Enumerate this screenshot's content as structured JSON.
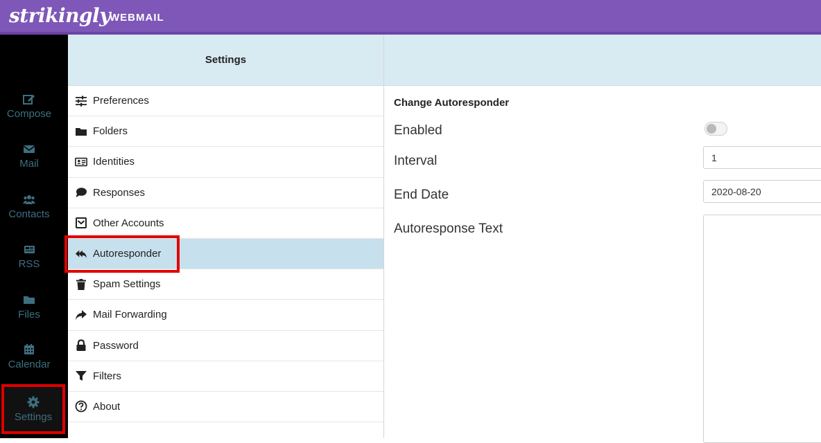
{
  "brand": {
    "logo": "strikingly",
    "product": "WEBMAIL"
  },
  "leftnav": {
    "items": [
      {
        "label": "Compose",
        "icon": "edit-icon"
      },
      {
        "label": "Mail",
        "icon": "envelope-icon"
      },
      {
        "label": "Contacts",
        "icon": "users-icon"
      },
      {
        "label": "RSS",
        "icon": "newspaper-icon"
      },
      {
        "label": "Files",
        "icon": "folder-icon"
      },
      {
        "label": "Calendar",
        "icon": "calendar-icon"
      },
      {
        "label": "Settings",
        "icon": "gear-icon",
        "active": true
      }
    ]
  },
  "settings": {
    "title": "Settings",
    "items": [
      {
        "label": "Preferences",
        "icon": "sliders-icon"
      },
      {
        "label": "Folders",
        "icon": "folder-icon"
      },
      {
        "label": "Identities",
        "icon": "id-card-icon"
      },
      {
        "label": "Responses",
        "icon": "comment-icon"
      },
      {
        "label": "Other Accounts",
        "icon": "envelope-square-icon"
      },
      {
        "label": "Autoresponder",
        "icon": "reply-all-icon",
        "selected": true
      },
      {
        "label": "Spam Settings",
        "icon": "trash-icon"
      },
      {
        "label": "Mail Forwarding",
        "icon": "share-icon"
      },
      {
        "label": "Password",
        "icon": "lock-icon"
      },
      {
        "label": "Filters",
        "icon": "filter-icon"
      },
      {
        "label": "About",
        "icon": "question-circle-icon"
      }
    ]
  },
  "form": {
    "title": "Change Autoresponder",
    "enabled_label": "Enabled",
    "enabled": false,
    "interval_label": "Interval",
    "interval_value": "1",
    "end_date_label": "End Date",
    "end_date_value": "2020-08-20",
    "text_label": "Autoresponse Text",
    "text_value": ""
  },
  "colors": {
    "topbar": "#7e57b8",
    "sidebar": "#000000",
    "nav_text": "#3d6f80",
    "panel_header": "#d9ebf2",
    "selected_row": "#c7e0ed",
    "highlight": "#e00000"
  }
}
